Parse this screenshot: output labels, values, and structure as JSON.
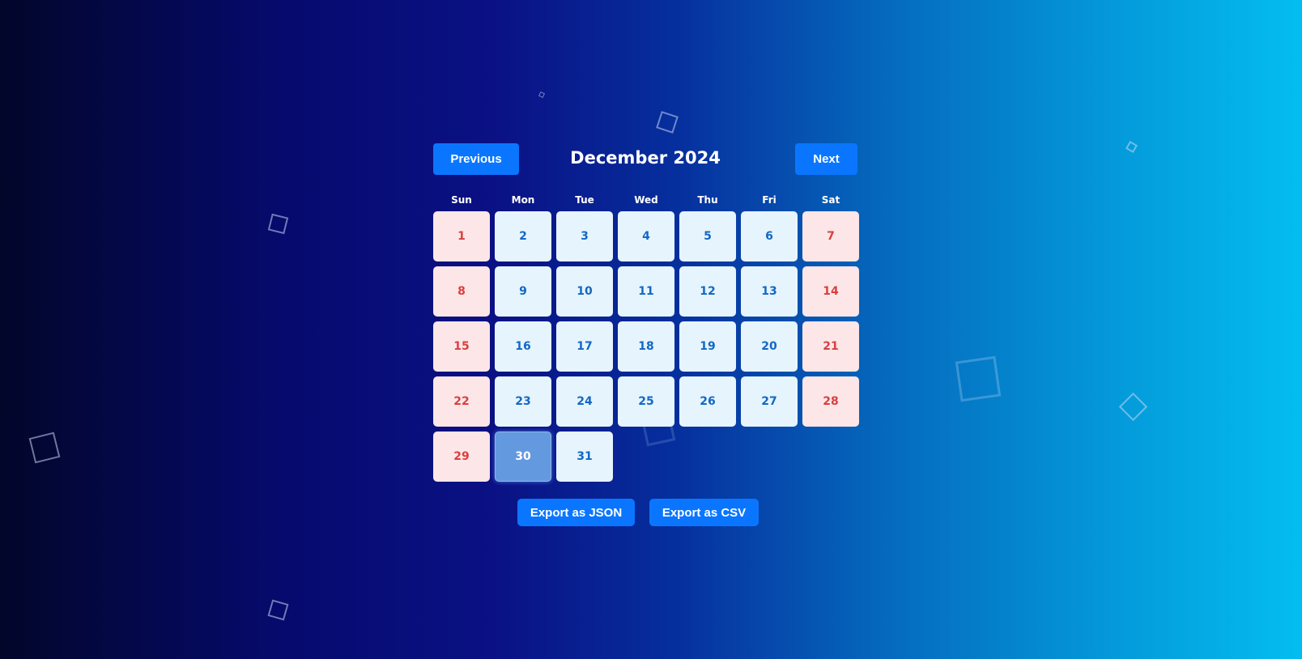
{
  "calendar": {
    "title": "December 2024",
    "prev_label": "Previous",
    "next_label": "Next",
    "weekdays": [
      "Sun",
      "Mon",
      "Tue",
      "Wed",
      "Thu",
      "Fri",
      "Sat"
    ],
    "days": [
      "1",
      "2",
      "3",
      "4",
      "5",
      "6",
      "7",
      "8",
      "9",
      "10",
      "11",
      "12",
      "13",
      "14",
      "15",
      "16",
      "17",
      "18",
      "19",
      "20",
      "21",
      "22",
      "23",
      "24",
      "25",
      "26",
      "27",
      "28",
      "29",
      "30",
      "31"
    ],
    "selected_day": "30"
  },
  "export": {
    "json_label": "Export as JSON",
    "csv_label": "Export as CSV"
  },
  "colors": {
    "accent": "#0a76ff",
    "weekday_cell": "#e6f4fd",
    "weekday_text": "#1368c4",
    "weekend_cell": "#fde6e7",
    "weekend_text": "#d8403f",
    "selected_cell": "#6399df"
  }
}
